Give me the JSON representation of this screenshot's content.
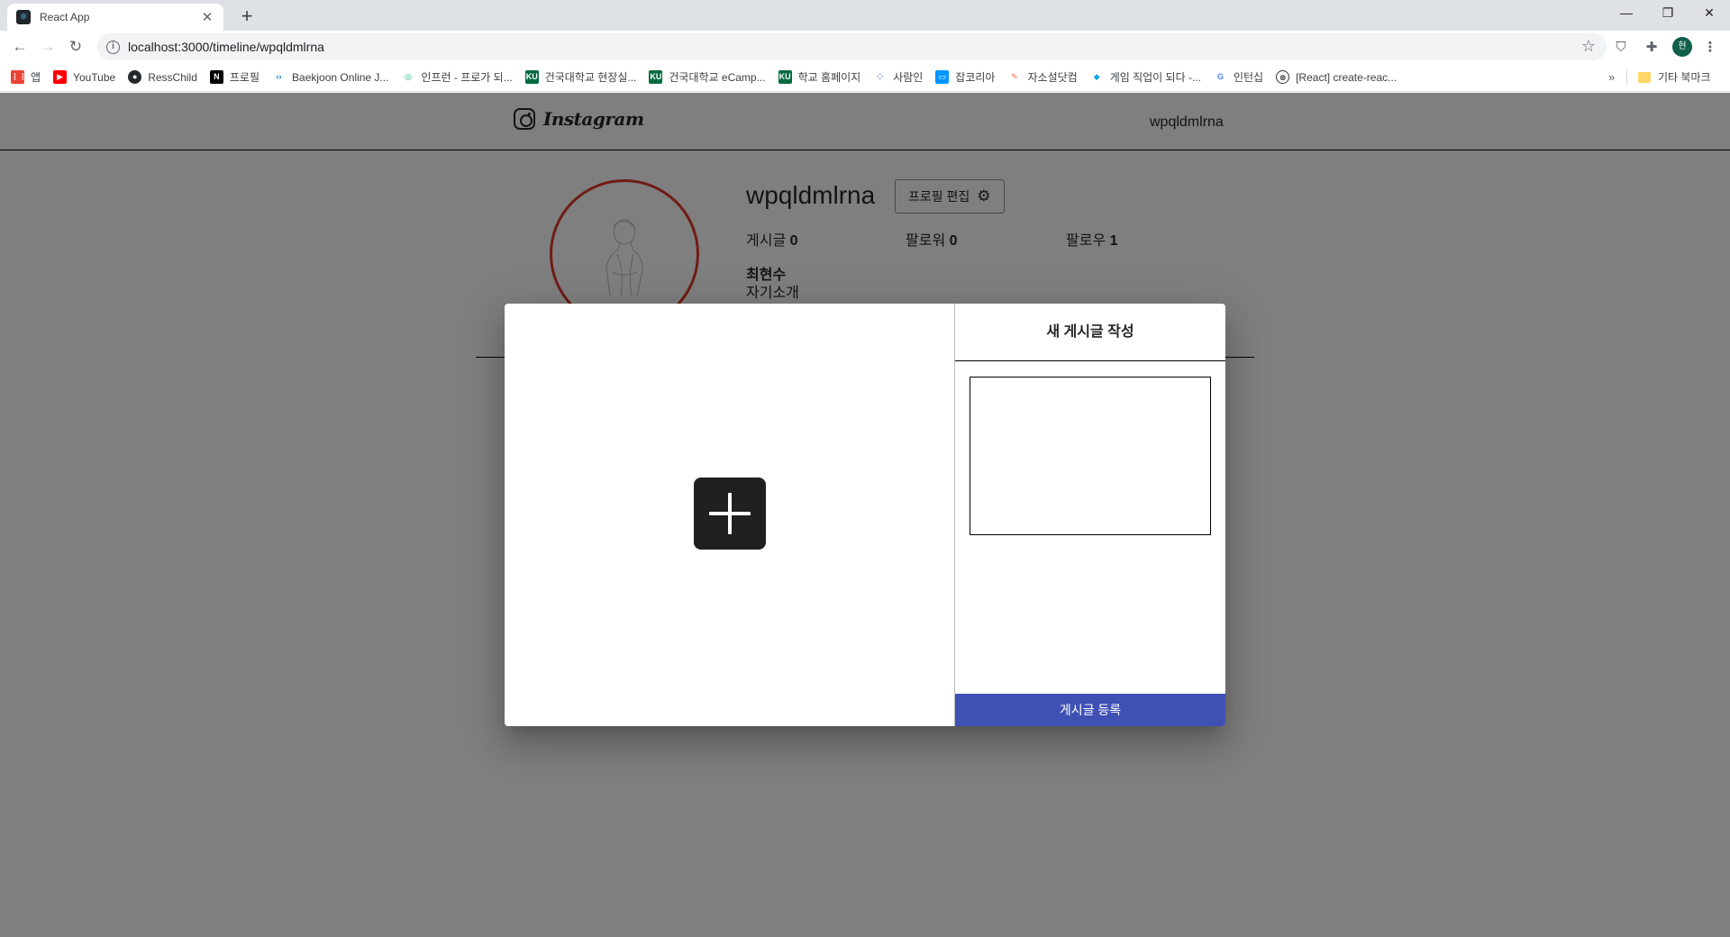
{
  "browser": {
    "tab_title": "React App",
    "new_tab": "+",
    "url": "localhost:3000/timeline/wpqldmlrna",
    "profile_initial": "현",
    "window_controls": {
      "minimize": "—",
      "restore": "❐",
      "close": "✕"
    }
  },
  "bookmarks": {
    "items": [
      {
        "label": "앱",
        "icon": "apps-grid-icon",
        "color": "#ea4335"
      },
      {
        "label": "YouTube",
        "icon": "youtube-icon",
        "color": "#ff0000"
      },
      {
        "label": "RessChild",
        "icon": "github-icon",
        "color": "#24292e"
      },
      {
        "label": "프로필",
        "icon": "notion-icon",
        "color": "#000000"
      },
      {
        "label": "Baekjoon Online J...",
        "icon": "code-icon",
        "color": "#0076c0"
      },
      {
        "label": "인프런 - 프로가 되...",
        "icon": "inflearn-icon",
        "color": "#1dc078"
      },
      {
        "label": "건국대학교 현장실...",
        "icon": "ku-icon",
        "color": "#036b3f"
      },
      {
        "label": "건국대학교 eCamp...",
        "icon": "ku-icon",
        "color": "#036b3f"
      },
      {
        "label": "학교 홈페이지",
        "icon": "ku-icon",
        "color": "#036b3f"
      },
      {
        "label": "사람인",
        "icon": "saramin-icon",
        "color": "#4876ef"
      },
      {
        "label": "잡코리아",
        "icon": "jobkorea-icon",
        "color": "#0094ff"
      },
      {
        "label": "자소설닷컴",
        "icon": "pen-icon",
        "color": "#ff6b4a"
      },
      {
        "label": "게임 직업이 되다 -...",
        "icon": "game-icon",
        "color": "#00a5e3"
      },
      {
        "label": "인턴십",
        "icon": "google-icon",
        "color": "#4285f4"
      },
      {
        "label": "[React] create-reac...",
        "icon": "velog-icon",
        "color": "#333333"
      }
    ],
    "more": "»",
    "other": "기타 북마크"
  },
  "app": {
    "logo_text": "Instagram",
    "header_username": "wpqldmlrna"
  },
  "profile": {
    "username": "wpqldmlrna",
    "edit_button": "프로필 편집",
    "stats": [
      {
        "label": "게시글",
        "value": "0"
      },
      {
        "label": "팔로워",
        "value": "0"
      },
      {
        "label": "팔로우",
        "value": "1"
      }
    ],
    "name": "최현수",
    "bio": "자기소개"
  },
  "modal": {
    "title": "새 게시글 작성",
    "textarea_value": "",
    "submit_label": "게시글 등록"
  },
  "colors": {
    "overlay": "rgba(0,0,0,0.5)",
    "submit": "#3f51b5",
    "profile_ring": "#e0392b"
  }
}
